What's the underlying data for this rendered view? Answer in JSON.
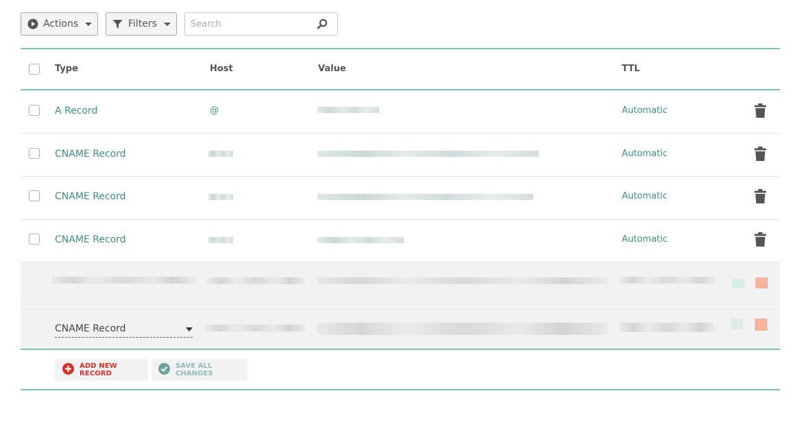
{
  "toolbar": {
    "actions_label": "Actions",
    "filters_label": "Filters",
    "search_placeholder": "Search"
  },
  "columns": [
    "Type",
    "Host",
    "Value",
    "TTL"
  ],
  "records": [
    {
      "type": "A Record",
      "host": "@",
      "ttl": "Automatic"
    },
    {
      "type": "CNAME Record",
      "host": "",
      "ttl": "Automatic"
    },
    {
      "type": "CNAME Record",
      "host": "",
      "ttl": "Automatic"
    },
    {
      "type": "CNAME Record",
      "host": "",
      "ttl": "Automatic"
    }
  ],
  "edit_rows": [
    {
      "type_selected": ""
    },
    {
      "type_selected": "CNAME Record"
    }
  ],
  "footer": {
    "add_label": "ADD NEW RECORD",
    "save_label": "SAVE ALL CHANGES"
  },
  "colors": {
    "accent_teal": "#3d8f84",
    "divider_teal": "#7fc2b8",
    "add_red": "#d6322a",
    "save_teal": "#6aa59d"
  },
  "icons": {
    "actions": "play-circle-icon",
    "filters": "funnel-icon",
    "search": "magnifier-icon",
    "delete": "trash-icon",
    "add": "plus-circle-icon",
    "save": "check-circle-icon"
  }
}
